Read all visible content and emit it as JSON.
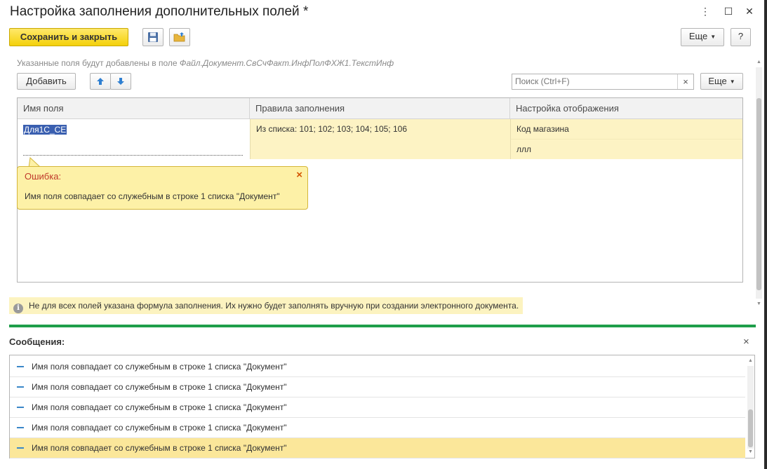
{
  "window": {
    "title": "Настройка заполнения дополнительных полей *",
    "menu_icon": "⋮",
    "maximize_icon": "☐",
    "close_icon": "✕"
  },
  "toolbar": {
    "save_close_label": "Сохранить и закрыть",
    "more_label": "Еще",
    "help_label": "?"
  },
  "form": {
    "hint_prefix": "Указанные поля будут добавлены в поле ",
    "hint_field": "Файл.Документ.СвСчФакт.ИнфПолФХЖ1.ТекстИнф",
    "add_label": "Добавить",
    "search_placeholder": "Поиск (Ctrl+F)",
    "search_clear": "×",
    "more_label": "Еще"
  },
  "table": {
    "columns": [
      "Имя поля",
      "Правила заполнения",
      "Настройка отображения"
    ],
    "row": {
      "field_name": "Для1С_СЕ",
      "rules": "Из списка: 101; 102; 103; 104; 105; 106",
      "display": [
        "Код магазина",
        "ллл"
      ]
    }
  },
  "error": {
    "title": "Ошибка:",
    "text": "Имя поля совпадает со служебным в строке 1 списка \"Документ\"",
    "close": "×"
  },
  "info_bar": {
    "icon_glyph": "i",
    "text": "Не для всех полей указана формула заполнения. Их нужно будет заполнять вручную при создании электронного документа."
  },
  "messages": {
    "title": "Сообщения:",
    "close": "×",
    "items": [
      "Имя поля совпадает со служебным в строке 1 списка \"Документ\"",
      "Имя поля совпадает со служебным в строке 1 списка \"Документ\"",
      "Имя поля совпадает со служебным в строке 1 списка \"Документ\"",
      "Имя поля совпадает со служебным в строке 1 списка \"Документ\"",
      "Имя поля совпадает со служебным в строке 1 списка \"Документ\""
    ]
  },
  "colors": {
    "accent_yellow": "#f4d10a",
    "divider_green": "#1e9e4a",
    "selection_blue": "#3a5fb0",
    "arrow_blue": "#2f7fd1"
  }
}
